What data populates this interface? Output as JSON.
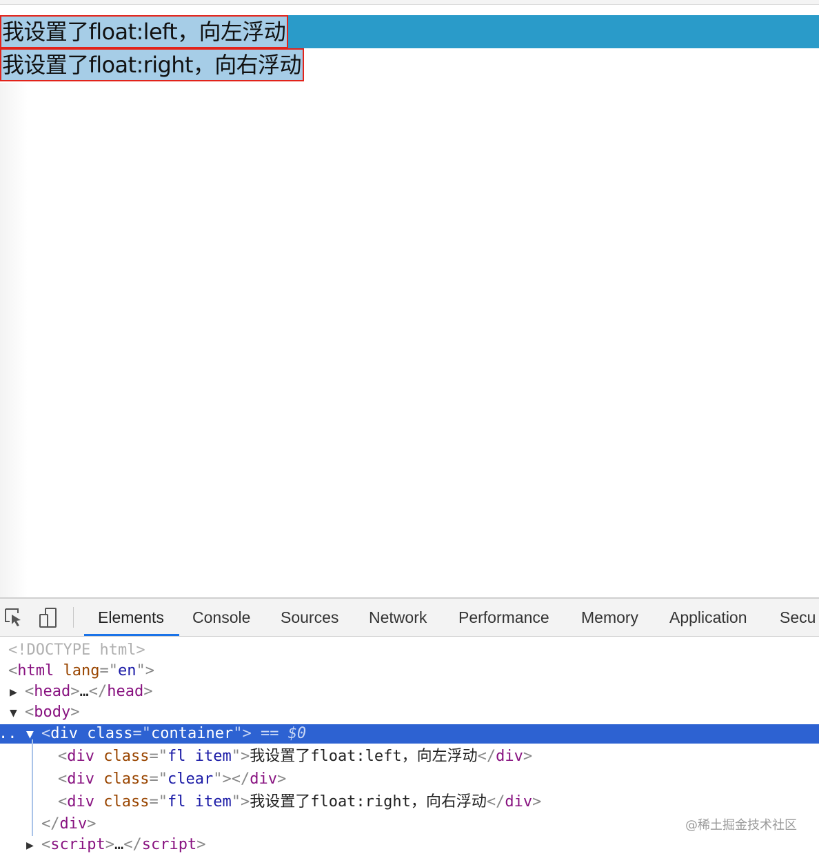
{
  "page": {
    "item_left_text": "我设置了float:left，向左浮动",
    "item_right_text": "我设置了float:right，向右浮动"
  },
  "devtools": {
    "tabs": [
      {
        "label": "Elements",
        "active": true
      },
      {
        "label": "Console"
      },
      {
        "label": "Sources"
      },
      {
        "label": "Network"
      },
      {
        "label": "Performance"
      },
      {
        "label": "Memory"
      },
      {
        "label": "Application"
      },
      {
        "label": "Secu"
      }
    ],
    "icons": [
      "inspect-element-icon",
      "device-toolbar-icon"
    ],
    "dom": {
      "doctype": "<!DOCTYPE html>",
      "html_tag": "html",
      "html_attr": "lang",
      "html_attr_val": "en",
      "head_tag": "head",
      "head_ellipsis": "…",
      "body_tag": "body",
      "div_tag": "div",
      "class_attr": "class",
      "container_val": "container",
      "selected_marker": "== $0",
      "fl_item_val": "fl item",
      "clear_val": "clear",
      "child1_text": "我设置了float:left，向左浮动",
      "child3_text": "我设置了float:right，向右浮动",
      "script_tag": "script",
      "script_ellipsis": "…"
    },
    "watermark": "@稀土掘金技术社区"
  },
  "colors": {
    "container_bg": "#2a9bc9",
    "item_bg": "#a6cde7",
    "item_border": "#e2231a",
    "selected_row": "#2d62d2",
    "active_tab_underline": "#1a73e8"
  }
}
